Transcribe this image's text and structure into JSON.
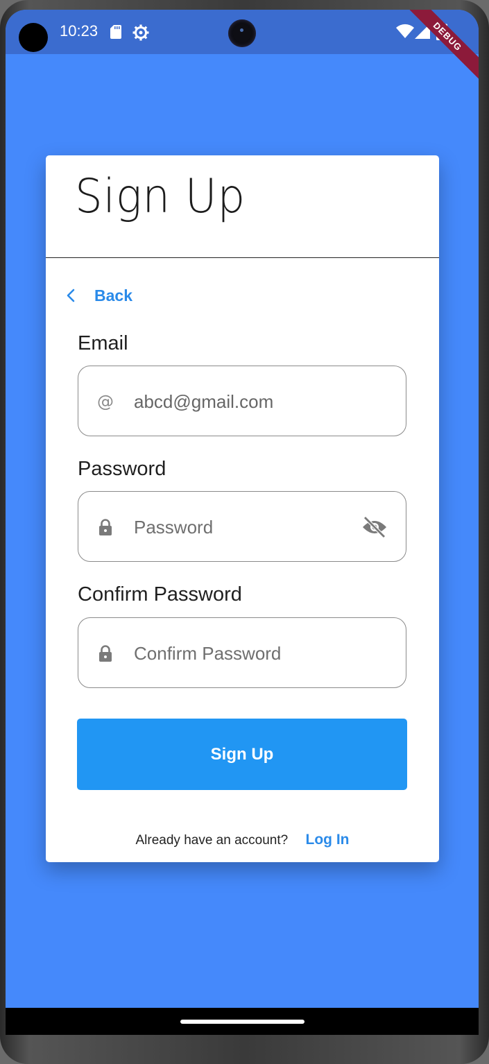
{
  "status_bar": {
    "time": "10:23"
  },
  "debug_banner": "DEBUG",
  "card": {
    "title": "Sign Up",
    "back_label": "Back",
    "email": {
      "label": "Email",
      "value": "abcd@gmail.com",
      "icon": "at-icon"
    },
    "password": {
      "label": "Password",
      "placeholder": "Password",
      "icon": "lock-icon",
      "toggle_icon": "eye-off-icon"
    },
    "confirm_password": {
      "label": "Confirm Password",
      "placeholder": "Confirm Password",
      "icon": "lock-icon"
    },
    "submit_label": "Sign Up",
    "footer_text": "Already have an account?",
    "login_label": "Log In"
  },
  "colors": {
    "background": "#4589fb",
    "status_bar": "#3b6ccf",
    "primary_button": "#2196f3",
    "link": "#2a8ae9",
    "debug_banner": "#8c1a3a"
  }
}
